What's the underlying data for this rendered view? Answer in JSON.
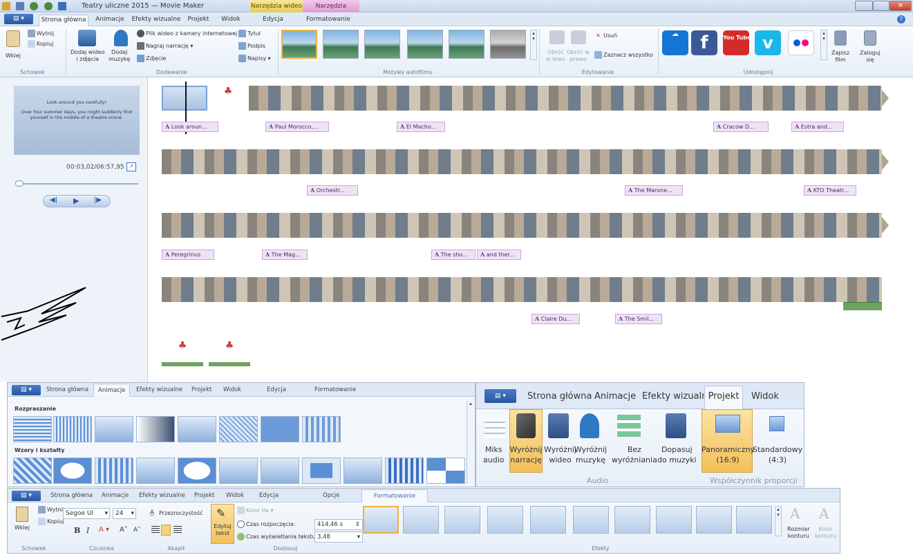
{
  "titlebar": {
    "title": "Teatry uliczne 2015 — Movie Maker",
    "ctx_video": "Narzędzia wideo",
    "ctx_text": "Narzędzia tekstowe"
  },
  "tabs": [
    "Strona główna",
    "Animacje",
    "Efekty wizualne",
    "Projekt",
    "Widok",
    "Edycja",
    "Formatowanie"
  ],
  "ribbon": {
    "clipboard": {
      "paste": "Wklej",
      "cut": "Wytnij",
      "copy": "Kopiuj",
      "label": "Schowek"
    },
    "add": {
      "add_video": "Dodaj wideo\ni zdjęcia",
      "add_music": "Dodaj\nmuzykę",
      "webcam": "Plik wideo z kamery internetowej",
      "narration": "Nagraj narrację",
      "snapshot": "Zdjęcie",
      "title": "Tytuł",
      "caption": "Podpis",
      "credits": "Napisy",
      "label": "Dodawanie"
    },
    "themes_label": "Motywy autofilmu",
    "edit": {
      "rotate_left": "Obróć\nw lewo",
      "rotate_right": "Obróć w\nprawo",
      "remove": "Usuń",
      "select_all": "Zaznacz wszystko",
      "label": "Edytowanie"
    },
    "share": {
      "youtube": "You Tube",
      "save_movie": "Zapisz\nfilm",
      "sign_in": "Zaloguj\nsię",
      "label": "Udostępnij"
    }
  },
  "preview": {
    "line1": "Look around you carefully!",
    "line2": "Over four summer days, you might suddenly find yourself in the middle of a theatre scene.",
    "time": "00:03,02/06:57,95"
  },
  "captions": {
    "row1": [
      "Look aroun...",
      "Paul Morocco,...",
      "El Macho...",
      "Cracow D...",
      "Estra and..."
    ],
    "row2": [
      "Orchestr...",
      "The Marone...",
      "KTO Theatr..."
    ],
    "row3": [
      "Peregrinus",
      "The Mag...",
      "The sho...",
      "and ther..."
    ],
    "row4": [
      "Claire Du...",
      "The Smil..."
    ]
  },
  "anim_panel": {
    "tabs": [
      "Strona główna",
      "Animacje",
      "Efekty wizualne",
      "Projekt",
      "Widok",
      "Edycja",
      "Formatowanie"
    ],
    "section1": "Rozpraszanie",
    "section2": "Wzory i kształty"
  },
  "project_panel": {
    "tabs": [
      "Strona główna",
      "Animacje",
      "Efekty wizualne",
      "Projekt",
      "Widok"
    ],
    "buttons": [
      "Miks\naudio",
      "Wyróżnij\nnarrację",
      "Wyróżnij\nwideo",
      "Wyróżnij\nmuzykę",
      "Bez\nwyróżniania",
      "Dopasuj\ndo muzyki",
      "Panoramiczny\n(16:9)",
      "Standardowy\n(4:3)"
    ],
    "audio_label": "Audio",
    "ratio_label": "Współczynnik proporcji"
  },
  "format_panel": {
    "tabs": [
      "Strona główna",
      "Animacje",
      "Efekty wizualne",
      "Projekt",
      "Widok",
      "Edycja",
      "Opcje",
      "Formatowanie"
    ],
    "paste": "Wklej",
    "cut": "Wytnij",
    "copy": "Kopiuj",
    "font": "Segoe UI",
    "size": "24",
    "transparency": "Przezroczystość",
    "edit_text": "Edytuj\ntekst",
    "bg_color": "Kolor tła",
    "start_time_label": "Czas rozpoczęcia:",
    "start_time": "414,46 s",
    "duration_label": "Czas wyświetlania tekstu:",
    "duration": "3,48",
    "outline_size": "Rozmiar\nkonturu",
    "outline_color": "Kolor\nkonturu",
    "groups": [
      "Schowek",
      "Czcionka",
      "Akapit",
      "Dostosuj",
      "Efekty"
    ]
  },
  "colors": {
    "accent": "#2a56a0",
    "caption_bg": "#efe2f6",
    "selected": "#f6d27a"
  }
}
